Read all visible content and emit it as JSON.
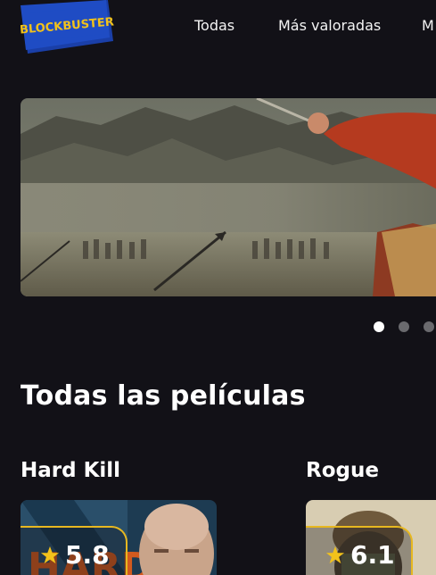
{
  "header": {
    "logo_text": "BLOCKBUSTER",
    "nav": [
      {
        "label": "Todas"
      },
      {
        "label": "Más valoradas"
      },
      {
        "label": "M"
      }
    ]
  },
  "hero": {
    "slides": 3,
    "active_slide": 1
  },
  "section": {
    "title": "Todas las películas"
  },
  "movies": [
    {
      "title": "Hard Kill",
      "rating": "5.8"
    },
    {
      "title": "Rogue",
      "rating": "6.1"
    }
  ],
  "colors": {
    "background": "#121117",
    "rating_border": "#e7b820",
    "logo_blue": "#1a3fa8",
    "logo_yellow": "#f2c21b"
  }
}
